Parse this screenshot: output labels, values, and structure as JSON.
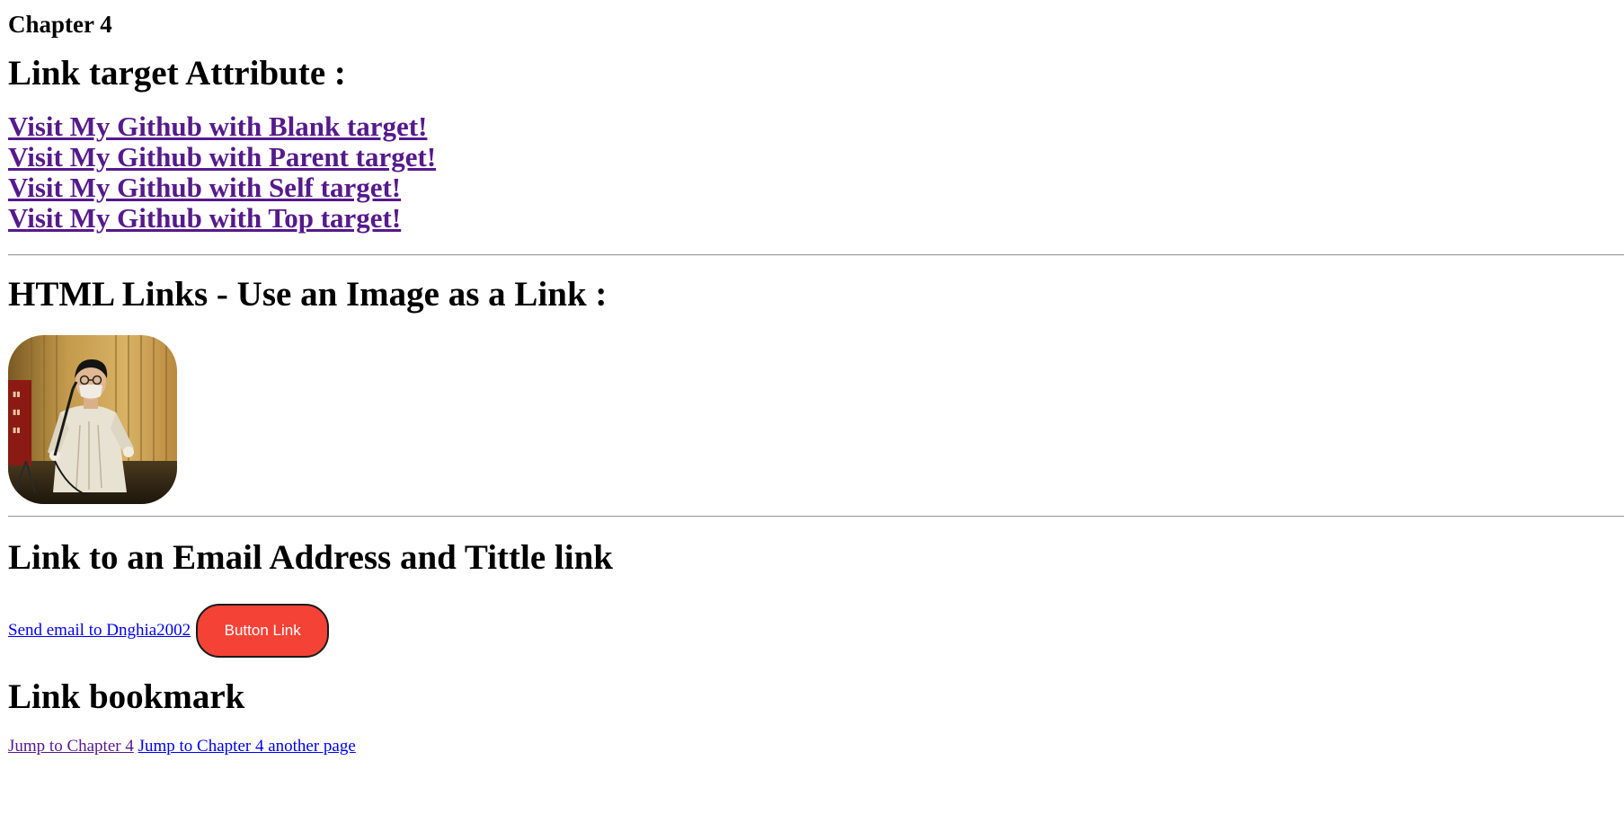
{
  "chapter_heading": "Chapter 4",
  "section_link_target": {
    "heading": "Link target Attribute :",
    "links": [
      "Visit My Github with Blank target!",
      "Visit My Github with Parent target!",
      "Visit My Github with Self target!",
      "Visit My Github with Top target!"
    ]
  },
  "section_image_link": {
    "heading": "HTML Links - Use an Image as a Link :"
  },
  "section_email": {
    "heading": "Link to an Email Address and Tittle link",
    "email_link": "Send email to Dnghia2002",
    "button_link": "Button Link"
  },
  "section_bookmark": {
    "heading": "Link bookmark",
    "jump_link": "Jump to Chapter 4",
    "jump_other_link": "Jump to Chapter 4 another page"
  },
  "colors": {
    "visited_link": "#551a8b",
    "unvisited_link": "#0000ee",
    "button_bg": "#f44336",
    "button_text": "#ffffff"
  }
}
